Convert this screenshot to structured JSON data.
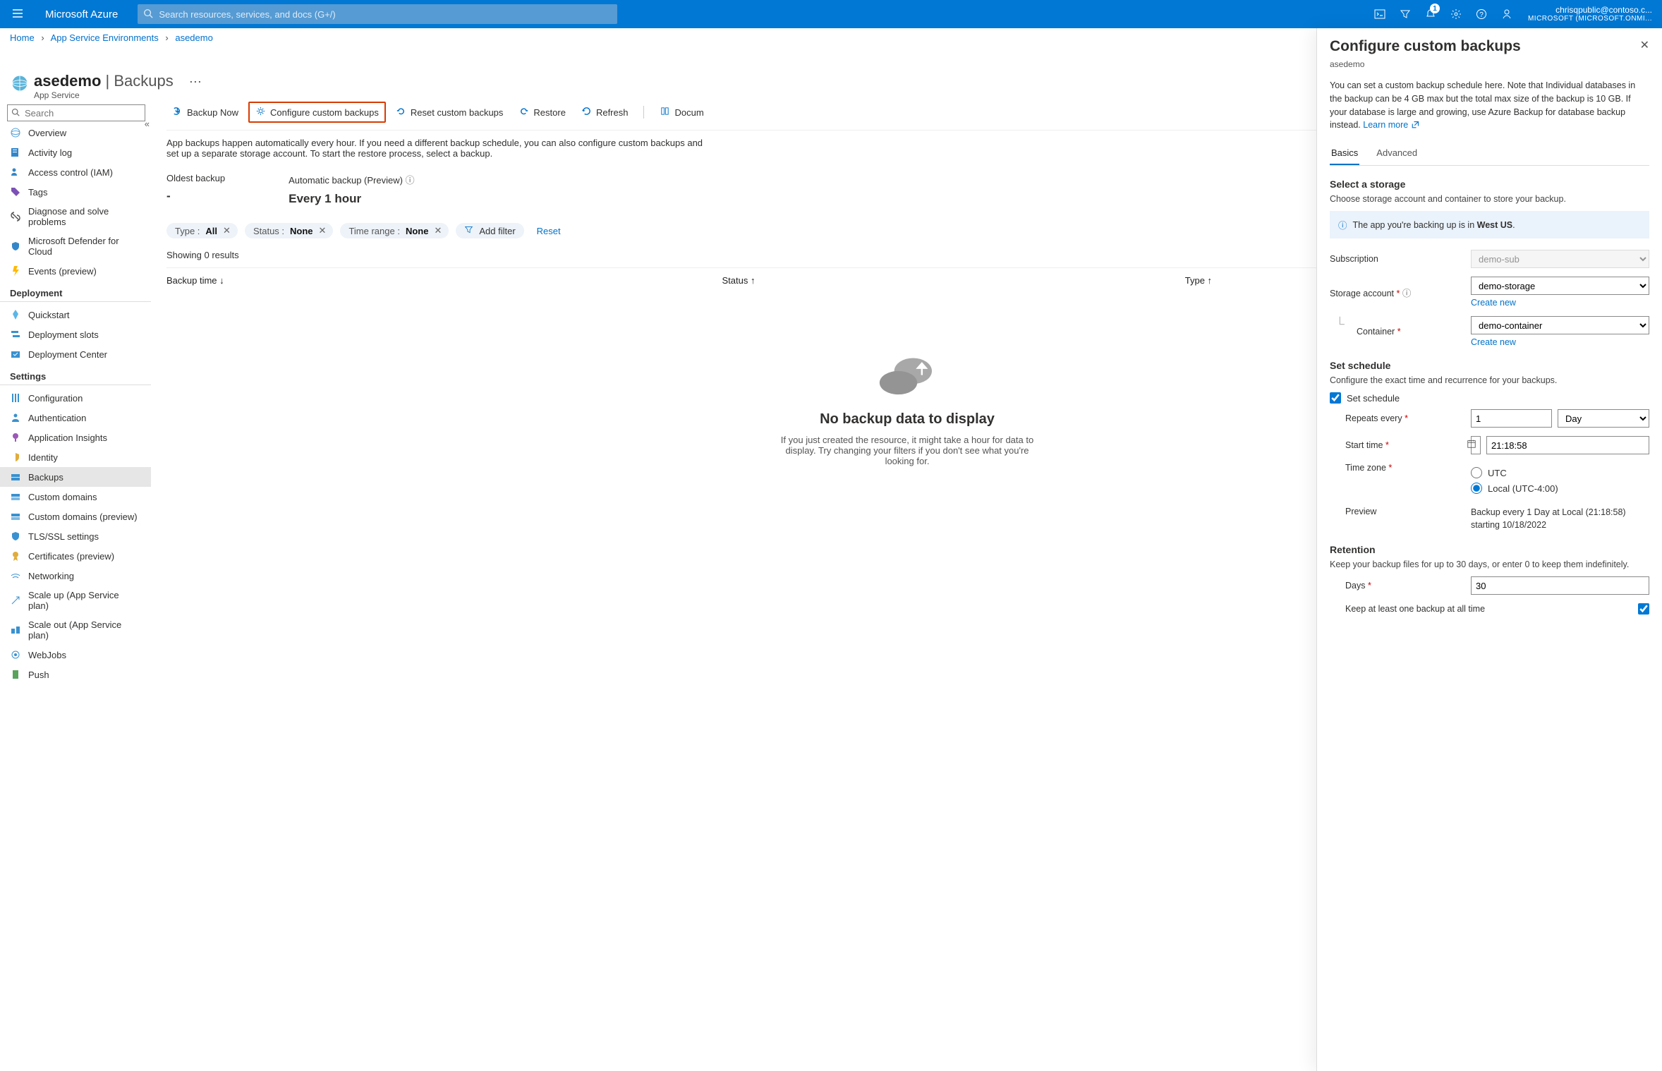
{
  "topbar": {
    "brand": "Microsoft Azure",
    "search_placeholder": "Search resources, services, and docs (G+/)",
    "notification_count": "1",
    "account": {
      "email": "chrisqpublic@contoso.c...",
      "tenant": "MICROSOFT (MICROSOFT.ONMI..."
    }
  },
  "breadcrumb": {
    "home": "Home",
    "ase": "App Service Environments",
    "res": "asedemo"
  },
  "title": {
    "main": "asedemo",
    "suffix": "Backups",
    "subtitle": "App Service"
  },
  "left_search_placeholder": "Search",
  "nav": {
    "items": [
      "Overview",
      "Activity log",
      "Access control (IAM)",
      "Tags",
      "Diagnose and solve problems",
      "Microsoft Defender for Cloud",
      "Events (preview)"
    ],
    "deploy_head": "Deployment",
    "deploy": [
      "Quickstart",
      "Deployment slots",
      "Deployment Center"
    ],
    "settings_head": "Settings",
    "settings": [
      "Configuration",
      "Authentication",
      "Application Insights",
      "Identity",
      "Backups",
      "Custom domains",
      "Custom domains (preview)",
      "TLS/SSL settings",
      "Certificates (preview)",
      "Networking",
      "Scale up (App Service plan)",
      "Scale out (App Service plan)",
      "WebJobs",
      "Push"
    ]
  },
  "toolbar": {
    "backup_now": "Backup Now",
    "configure": "Configure custom backups",
    "reset": "Reset custom backups",
    "restore": "Restore",
    "refresh": "Refresh",
    "docs": "Docum"
  },
  "desc": "App backups happen automatically every hour. If you need a different backup schedule, you can also configure custom backups and set up a separate storage account. To start the restore process, select a backup.",
  "cards": {
    "oldest_label": "Oldest backup",
    "oldest_val": "-",
    "auto_label": "Automatic backup (Preview)",
    "auto_val": "Every 1 hour"
  },
  "chips": {
    "type_label": "Type : ",
    "type_val": "All",
    "status_label": "Status : ",
    "status_val": "None",
    "time_label": "Time range : ",
    "time_val": "None",
    "add": "Add filter",
    "reset": "Reset"
  },
  "showing": "Showing 0 results",
  "thead": {
    "time": "Backup time",
    "status": "Status",
    "type": "Type"
  },
  "empty": {
    "title": "No backup data to display",
    "body": "If you just created the resource, it might take a hour for data to display. Try changing your filters if you don't see what you're looking for."
  },
  "blade": {
    "title": "Configure custom backups",
    "subtitle": "asedemo",
    "desc": "You can set a custom backup schedule here. Note that Individual databases in the backup can be 4 GB max but the total max size of the backup is 10 GB. If your database is large and growing, use Azure Backup for database backup instead. ",
    "learn": "Learn more",
    "tabs": {
      "basics": "Basics",
      "advanced": "Advanced"
    },
    "storage_h": "Select a storage",
    "storage_d": "Choose storage account and container to store your backup.",
    "info_prefix": "The app you're backing up is in ",
    "info_region": "West US",
    "subscription_label": "Subscription",
    "subscription_val": "demo-sub",
    "sa_label": "Storage account",
    "sa_val": "demo-storage",
    "create_new": "Create new",
    "container_label": "Container",
    "container_val": "demo-container",
    "sched_h": "Set schedule",
    "sched_d": "Configure the exact time and recurrence for your backups.",
    "sched_check": "Set schedule",
    "repeats_label": "Repeats every",
    "repeats_val": "1",
    "repeats_unit": "Day",
    "start_label": "Start time",
    "start_date": "10/18/2022",
    "start_time": "21:18:58",
    "tz_label": "Time zone",
    "tz_utc": "UTC",
    "tz_local": "Local (UTC-4:00)",
    "preview_label": "Preview",
    "preview_val": "Backup every 1 Day at Local (21:18:58) starting 10/18/2022",
    "ret_h": "Retention",
    "ret_d": "Keep your backup files for up to 30 days, or enter 0 to keep them indefinitely.",
    "days_label": "Days",
    "days_val": "30",
    "keep_label": "Keep at least one backup at all time"
  }
}
